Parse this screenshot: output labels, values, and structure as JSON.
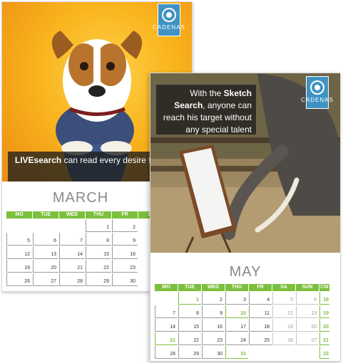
{
  "march": {
    "logo_text": "CADENAS",
    "caption_bold": "LIVEsearch",
    "caption_rest": " can read every desire from your eyes",
    "month": "MARCH",
    "weekdays": [
      "MO",
      "TUE",
      "WED",
      "THU",
      "FR",
      "SA"
    ],
    "weeks": [
      [
        "",
        "",
        "",
        "1",
        "2",
        ""
      ],
      [
        "5",
        "6",
        "7",
        "8",
        "9",
        ""
      ],
      [
        "12",
        "13",
        "14",
        "15",
        "16",
        ""
      ],
      [
        "19",
        "20",
        "21",
        "22",
        "23",
        ""
      ],
      [
        "26",
        "27",
        "28",
        "29",
        "30",
        ""
      ]
    ]
  },
  "may": {
    "logo_text": "CADENAS",
    "caption_pre": "With the ",
    "caption_bold": "Sketch Search",
    "caption_rest": ", anyone can reach his target without any special talent",
    "month": "MAY",
    "weekdays": [
      "MO",
      "TUE",
      "WED",
      "THU",
      "FR",
      "SA",
      "SUN",
      "CW"
    ],
    "weeks": [
      [
        "",
        "1",
        "2",
        "3",
        "4",
        "5",
        "6",
        "18"
      ],
      [
        "7",
        "8",
        "9",
        "10",
        "11",
        "12",
        "13",
        "19"
      ],
      [
        "14",
        "15",
        "16",
        "17",
        "18",
        "19",
        "20",
        "20"
      ],
      [
        "21",
        "22",
        "23",
        "24",
        "25",
        "26",
        "27",
        "21"
      ],
      [
        "28",
        "29",
        "30",
        "31",
        "",
        "",
        "",
        "22"
      ]
    ],
    "holidays": [
      "1",
      "10",
      "20",
      "21",
      "31"
    ]
  }
}
